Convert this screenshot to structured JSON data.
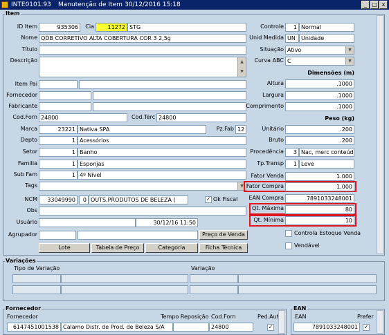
{
  "window": {
    "title_code": "INTE0101.93",
    "title_name": "Manutenção de Item",
    "title_date": "30/12/2016 15:18",
    "btn_min": "_",
    "btn_max": "□",
    "btn_close": "x"
  },
  "item": {
    "frame_title": "Item",
    "id_label": "ID Item",
    "id_value": "935306",
    "cia_label": "Cia",
    "cia_value": "11272",
    "cia_desc": "STG",
    "nome_label": "Nome",
    "nome_value": "QDB CORRETIVO ALTA COBERTURA COR 3 2,5g",
    "titulo_label": "Título",
    "descricao_label": "Descrição",
    "itempai_label": "Item Pai",
    "fornecedor_label": "Fornecedor",
    "fabricante_label": "Fabricante",
    "codforn_label": "Cod.Forn",
    "codforn_value": "24800",
    "codterc_label": "Cod.Terc",
    "codterc_value": "24800",
    "marca_label": "Marca",
    "marca_code": "23221",
    "marca_desc": "Nativa SPA",
    "pzfab_label": "Pz.Fab",
    "pzfab_value": "12",
    "depto_label": "Depto",
    "depto_code": "1",
    "depto_desc": "Acessórios",
    "setor_label": "Setor",
    "setor_code": "1",
    "setor_desc": "Banho",
    "familia_label": "Familia",
    "familia_code": "1",
    "familia_desc": "Esponjas",
    "subfam_label": "Sub Fam",
    "subfam_code": "1",
    "subfam_desc": "4º Nível",
    "tags_label": "Tags",
    "ncm_label": "NCM",
    "ncm_value": "33049990",
    "ncm_code": "0",
    "ncm_desc": "OUTS.PRODUTOS  DE  BELEZA  (",
    "okfiscal_label": "Ok Fiscal",
    "okfiscal_check": "✓",
    "obs_label": "Obs",
    "usuario_label": "Usuário",
    "usuario_date": "30/12/16 11:50",
    "agrupador_label": "Agrupador",
    "precovenda_btn": "Preço de Venda",
    "lote_btn": "Lote",
    "tabela_btn": "Tabela de Preço",
    "categoria_btn": "Categoria",
    "ficha_btn": "Ficha Técnica",
    "controle_label": "Controle",
    "controle_code": "1",
    "controle_desc": "Normal",
    "unid_label": "Unid Medida",
    "unid_code": "UN",
    "unid_desc": "Unidade",
    "situacao_label": "Situação",
    "situacao_value": "Ativo",
    "curva_label": "Curva ABC",
    "curva_value": "C",
    "dimensoes_title": "Dimensões (m)",
    "altura_label": "Altura",
    "altura_value": ".1000",
    "largura_label": "Largura",
    "largura_value": ".1000",
    "comprimento_label": "Comprimento",
    "comprimento_value": ".1000",
    "peso_title": "Peso (kg)",
    "unitario_label": "Unitário",
    "unitario_value": ".200",
    "bruto_label": "Bruto",
    "bruto_value": ".200",
    "procedencia_label": "Procedência",
    "procedencia_code": "3",
    "procedencia_desc": "Nac, merc conteúdo",
    "tptransp_label": "Tp.Transp",
    "tptransp_code": "1",
    "tptransp_desc": "Leve",
    "fatorvenda_label": "Fator Venda",
    "fatorvenda_value": "1.000",
    "fatorcompra_label": "Fator Compra",
    "fatorcompra_value": "1.000",
    "eancompra_label": "EAN Compra",
    "eancompra_value": "7891033248001",
    "qtmax_label": "Qt. Máxima",
    "qtmax_value": "80",
    "qtmin_label": "Qt. Mínima",
    "qtmin_value": "10",
    "ctrlestoque_label": "Controla Estoque Venda",
    "vendavel_label": "Vendável"
  },
  "variacoes": {
    "title": "Variações",
    "col1": "Tipo de Variação",
    "col2": "Variação"
  },
  "fornecedor": {
    "title": "Fornecedor",
    "col_forn": "Fornecedor",
    "col_tempo": "Tempo Reposição",
    "col_codforn": "Cod.Forn",
    "col_ped": "Ped.Auto",
    "row_cnpj": "6147451001538",
    "row_name": "Calamo Distr. de Prod. de Beleza S/A",
    "row_codforn": "24800",
    "row_ped": "✓"
  },
  "ean": {
    "title": "EAN",
    "col_ean": "EAN",
    "col_prefer": "Prefer",
    "row_ean": "7891033248001",
    "row_prefer": "✓"
  },
  "icons": {
    "app": "app-icon",
    "scroll_up": "▲",
    "scroll_down": "▼",
    "dropdown": "▼"
  }
}
